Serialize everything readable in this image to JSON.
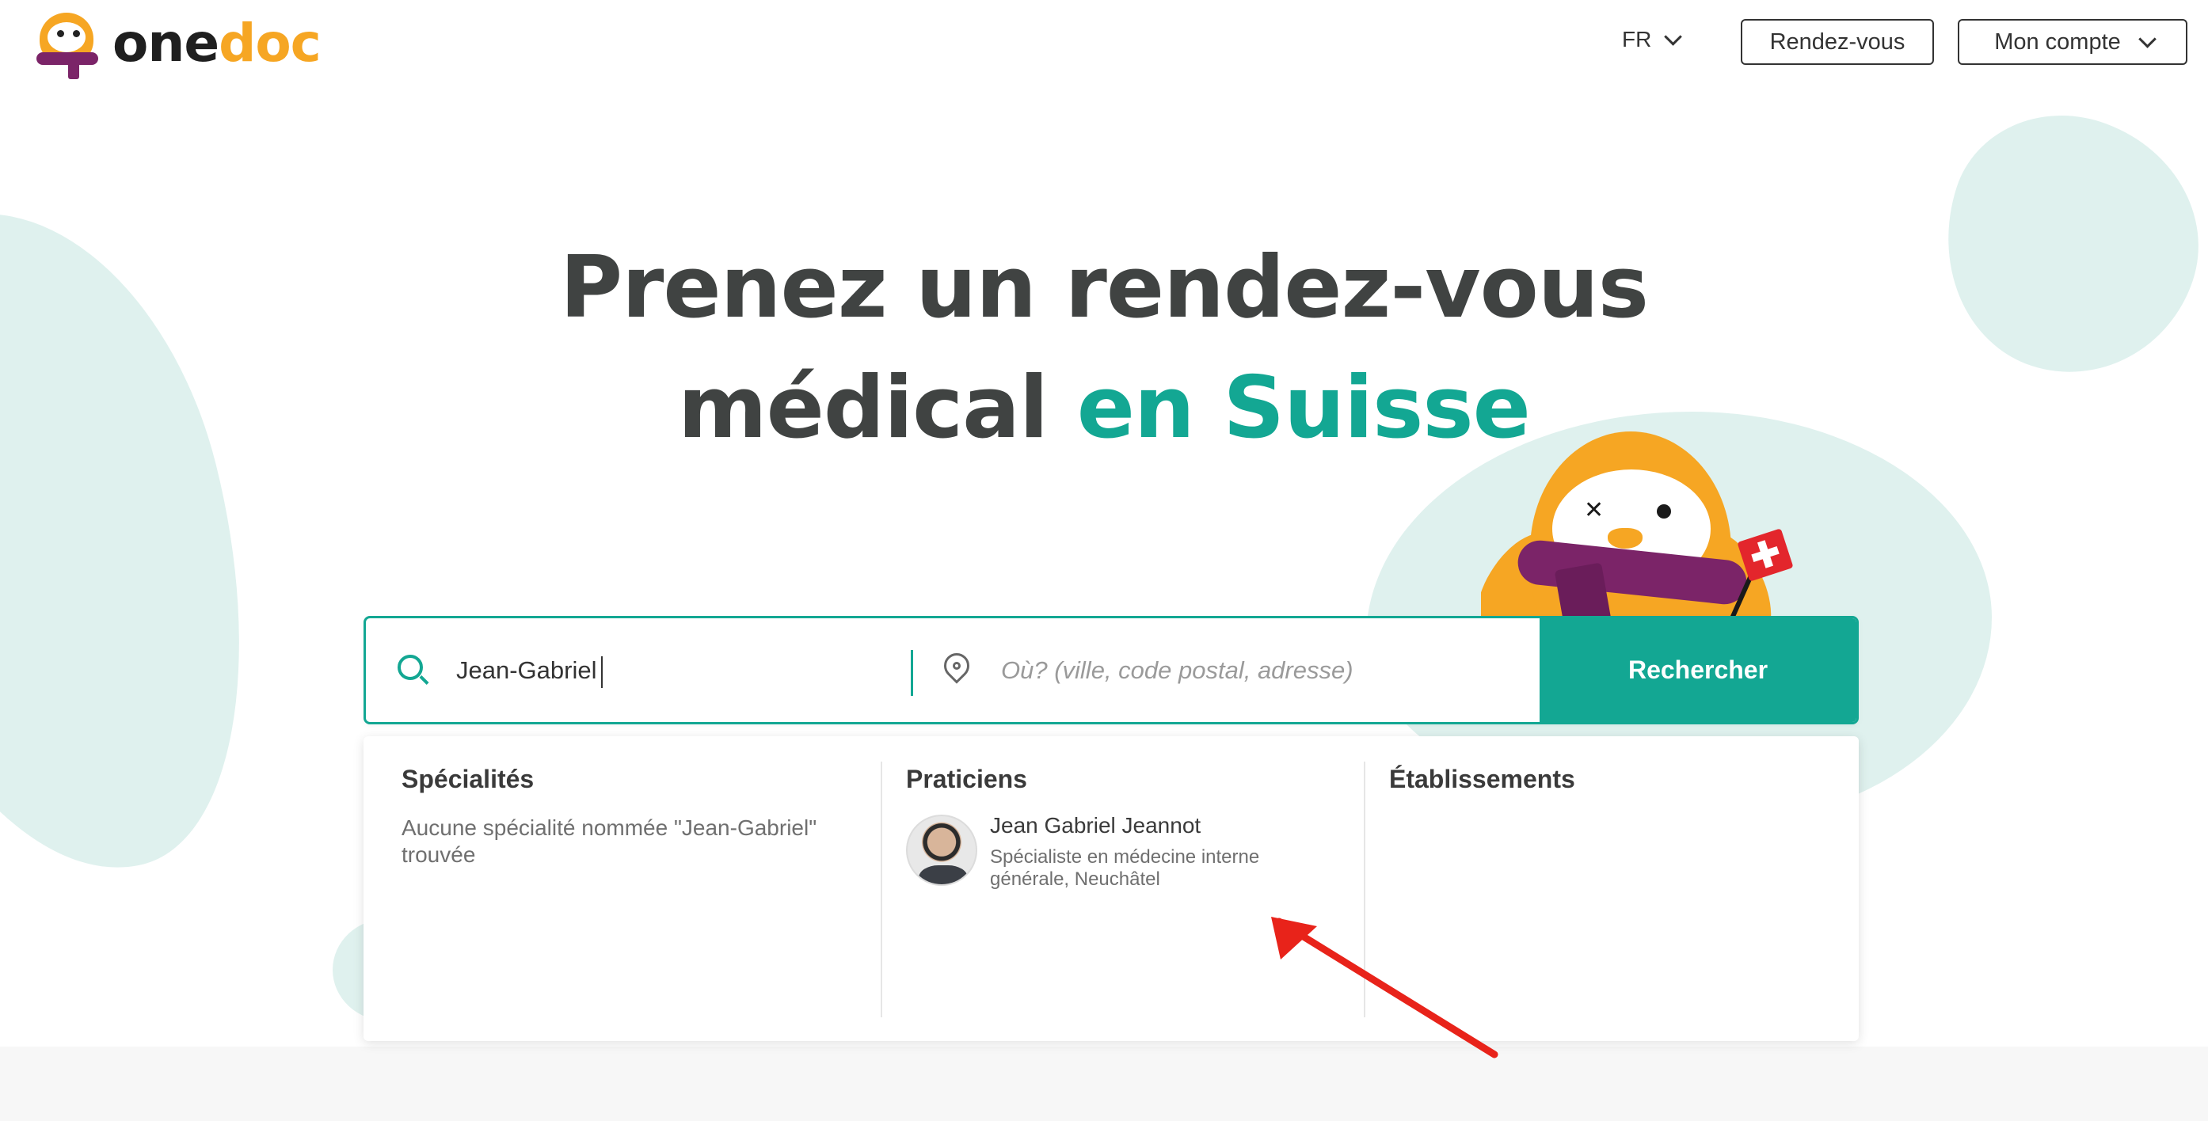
{
  "header": {
    "logo": {
      "part1": "one",
      "part2": "doc"
    },
    "language": "FR",
    "appointments_button": "Rendez-vous",
    "account_button": "Mon compte"
  },
  "hero": {
    "title_line1": "Prenez un rendez-vous",
    "title_line2_plain": "médical ",
    "title_line2_accent": "en Suisse"
  },
  "search": {
    "query_value": "Jean-Gabriel",
    "location_placeholder": "Où? (ville, code postal, adresse)",
    "submit_label": "Rechercher"
  },
  "results": {
    "specialties": {
      "title": "Spécialités",
      "empty_message": "Aucune spécialité nommée \"Jean-Gabriel\" trouvée"
    },
    "practitioners": {
      "title": "Praticiens",
      "items": [
        {
          "name": "Jean Gabriel Jeannot",
          "description": "Spécialiste en médecine interne générale, Neuchâtel"
        }
      ]
    },
    "establishments": {
      "title": "Établissements"
    }
  },
  "colors": {
    "brand_teal": "#13a793",
    "brand_orange": "#f6a623",
    "brand_purple": "#7b2468",
    "annotation_red": "#e8231a"
  },
  "icons": [
    "search-icon",
    "location-pin-icon",
    "chevron-down-icon"
  ]
}
